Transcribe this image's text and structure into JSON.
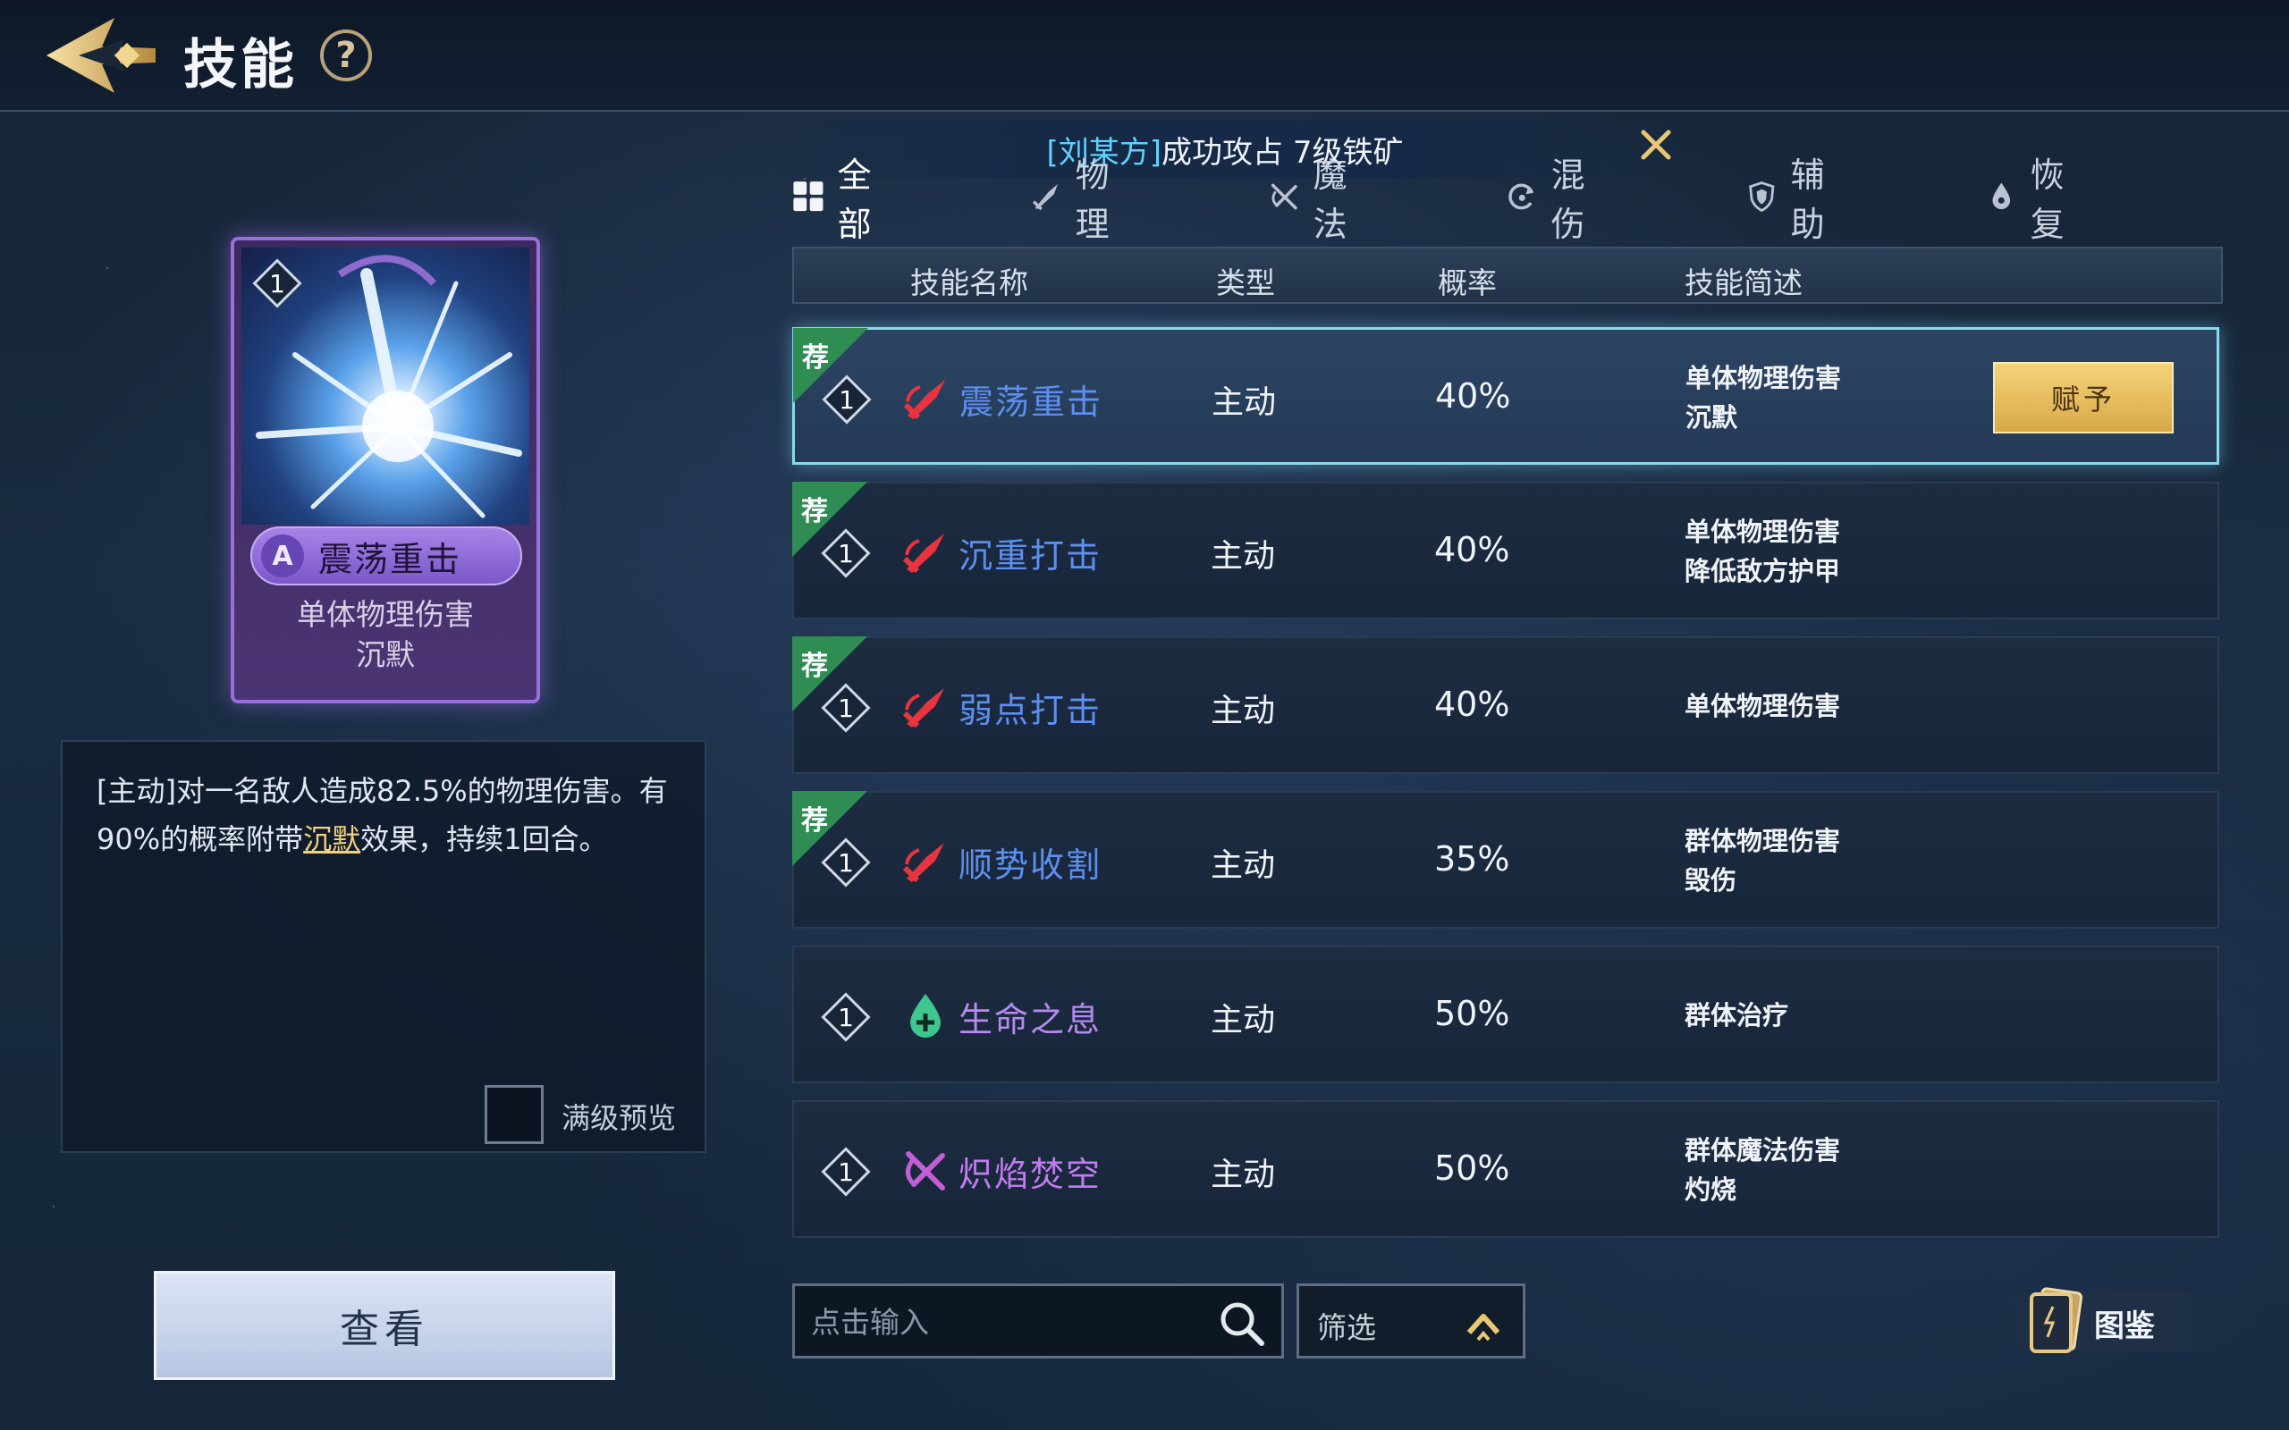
{
  "header": {
    "title": "技能",
    "help_label": "?"
  },
  "notice": {
    "name": "[刘某方]",
    "message": "成功攻占 7级铁矿"
  },
  "tabs": [
    {
      "label": "全部",
      "icon": "grid-icon",
      "active": true
    },
    {
      "label": "物理",
      "icon": "sword-icon",
      "active": false
    },
    {
      "label": "魔法",
      "icon": "magic-icon",
      "active": false
    },
    {
      "label": "混伤",
      "icon": "swirl-icon",
      "active": false
    },
    {
      "label": "辅助",
      "icon": "shield-icon",
      "active": false
    },
    {
      "label": "恢复",
      "icon": "drop-icon",
      "active": false
    }
  ],
  "table": {
    "headers": {
      "name": "技能名称",
      "type": "类型",
      "rate": "概率",
      "desc": "技能简述"
    },
    "rows": [
      {
        "recommended": "荐",
        "level": "1",
        "icon": "sword-icon",
        "name": "震荡重击",
        "type": "主动",
        "rate": "40%",
        "desc1": "单体物理伤害",
        "desc2": "沉默",
        "selected": true,
        "action": "赋予"
      },
      {
        "recommended": "荐",
        "level": "1",
        "icon": "sword-icon",
        "name": "沉重打击",
        "type": "主动",
        "rate": "40%",
        "desc1": "单体物理伤害",
        "desc2": "降低敌方护甲"
      },
      {
        "recommended": "荐",
        "level": "1",
        "icon": "sword-icon",
        "name": "弱点打击",
        "type": "主动",
        "rate": "40%",
        "desc1": "单体物理伤害",
        "desc2": ""
      },
      {
        "recommended": "荐",
        "level": "1",
        "icon": "sword-icon",
        "name": "顺势收割",
        "type": "主动",
        "rate": "35%",
        "desc1": "群体物理伤害",
        "desc2": "毁伤"
      },
      {
        "recommended": "",
        "level": "1",
        "icon": "heal-drop-icon",
        "name": "生命之息",
        "type": "主动",
        "rate": "50%",
        "desc1": "群体治疗",
        "desc2": ""
      },
      {
        "recommended": "",
        "level": "1",
        "icon": "magic-icon",
        "name": "炽焰焚空",
        "type": "主动",
        "rate": "50%",
        "desc1": "群体魔法伤害",
        "desc2": "灼烧"
      }
    ]
  },
  "card": {
    "level": "1",
    "grade": "A",
    "name": "震荡重击",
    "desc1": "单体物理伤害",
    "desc2": "沉默"
  },
  "detail": {
    "text_before": "[主动]对一名敌人造成82.5%的物理伤害。有90%的概率附带",
    "highlight": "沉默",
    "text_after": "效果，持续1回合。",
    "max_level_label": "满级预览"
  },
  "view_button": "查看",
  "search": {
    "placeholder": "点击输入"
  },
  "filter": {
    "label": "筛选"
  },
  "codex": {
    "label": "图鉴"
  },
  "colors": {
    "name_physical": "#5d8ff0",
    "name_heal": "#b48af0",
    "name_magic": "#c07cf0",
    "icon_physical": "#e8343f",
    "icon_heal": "#3fc58f",
    "icon_magic": "#c25fd6",
    "gold_button": "#e6bd5d",
    "selected_border": "#8bd9ec"
  }
}
